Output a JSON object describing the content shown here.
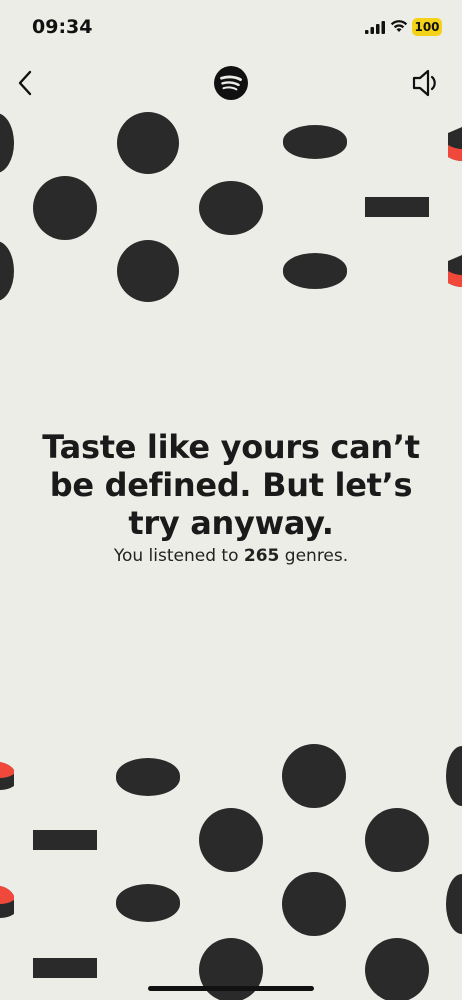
{
  "status": {
    "time": "09:34",
    "battery": "100"
  },
  "header": {
    "back_icon": "chevron-left-icon",
    "logo_icon": "spotify-logo-icon",
    "sound_icon": "speaker-icon"
  },
  "content": {
    "headline_line1": "Taste like yours can’t",
    "headline_line2": "be defined. But let’s",
    "headline_line3": "try anyway.",
    "sub_prefix": "You listened to ",
    "genre_count": "265",
    "sub_suffix": " genres."
  },
  "colors": {
    "background": "#EDEDE8",
    "shape": "#2A2A2A",
    "accent": "#F0483A",
    "battery": "#F5D21A"
  }
}
